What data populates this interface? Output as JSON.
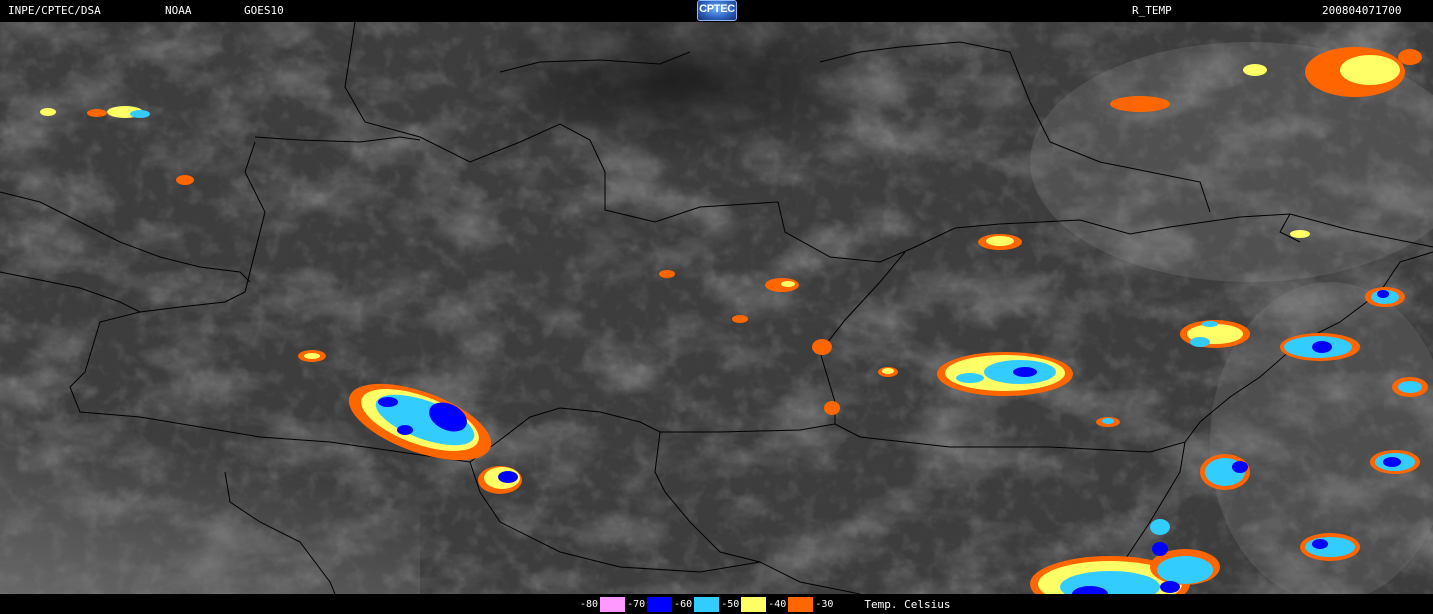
{
  "header": {
    "institution": "INPE/CPTEC/DSA",
    "agency": "NOAA",
    "satellite": "GOES10",
    "logo_text": "CPTEC",
    "product": "R_TEMP",
    "timestamp": "200804071700"
  },
  "legend": {
    "items": [
      {
        "label": "-80",
        "color": "#ff99ff"
      },
      {
        "label": "-70",
        "color": "#0000ff"
      },
      {
        "label": "-60",
        "color": "#33ccff"
      },
      {
        "label": "-50",
        "color": "#ffff66"
      },
      {
        "label": "-40",
        "color": "#ff6600"
      },
      {
        "label": "-30",
        "color": "#000000"
      }
    ],
    "unit": "Temp. Celsius"
  }
}
